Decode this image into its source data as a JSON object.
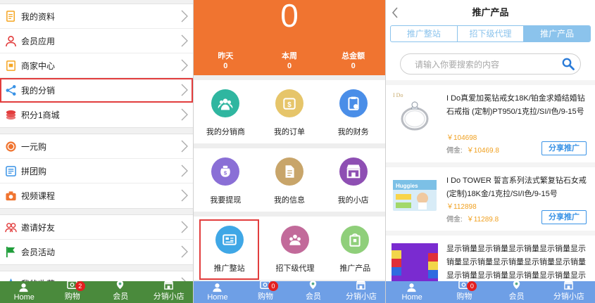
{
  "panel1": {
    "menu_groups": [
      [
        {
          "label": "我的资料",
          "icon": "document-icon",
          "color": "#f5a623"
        },
        {
          "label": "会员应用",
          "icon": "user-icon",
          "color": "#e23d3d"
        },
        {
          "label": "商家中心",
          "icon": "store-doc-icon",
          "color": "#f5a623"
        },
        {
          "label": "我的分销",
          "icon": "share-icon",
          "color": "#3a93e6",
          "selected": true
        },
        {
          "label": "积分1商城",
          "icon": "coins-icon",
          "color": "#e23d3d"
        }
      ],
      [
        {
          "label": "一元购",
          "icon": "coin-circle-icon",
          "color": "#f07430"
        },
        {
          "label": "拼团购",
          "icon": "group-buy-icon",
          "color": "#3a93e6"
        },
        {
          "label": "视频课程",
          "icon": "camera-icon",
          "color": "#f07430"
        }
      ],
      [
        {
          "label": "邀请好友",
          "icon": "friends-icon",
          "color": "#e23d3d"
        },
        {
          "label": "会员活动",
          "icon": "flag-icon",
          "color": "#1f9d3a"
        }
      ],
      [
        {
          "label": "我的收藏",
          "icon": "star-icon",
          "color": "#3a93e6"
        }
      ]
    ],
    "tabbar": {
      "bg": "#4a8a3c",
      "tabs": [
        {
          "label": "Home",
          "icon": "home-icon"
        },
        {
          "label": "购物",
          "icon": "cart-icon",
          "badge": "2"
        },
        {
          "label": "会员",
          "icon": "member-icon"
        },
        {
          "label": "分销小店",
          "icon": "shop-icon"
        }
      ]
    }
  },
  "panel2": {
    "header_bg": "#f07430",
    "big_number": "0",
    "stats": [
      {
        "label": "昨天",
        "value": "0"
      },
      {
        "label": "本周",
        "value": "0"
      },
      {
        "label": "总金额",
        "value": "0"
      }
    ],
    "grid_rows": [
      [
        {
          "label": "我的分销商",
          "icon": "team-icon",
          "color": "#2fb6a0"
        },
        {
          "label": "我的订单",
          "icon": "money-bag-icon",
          "color": "#e6c56a"
        },
        {
          "label": "我的财务",
          "icon": "finance-icon",
          "color": "#4a8ee8"
        }
      ],
      [
        {
          "label": "我要提现",
          "icon": "wallet-bag-icon",
          "color": "#8a6fd6"
        },
        {
          "label": "我的信息",
          "icon": "info-doc-icon",
          "color": "#c8a56a"
        },
        {
          "label": "我的小店",
          "icon": "shop-icon",
          "color": "#8e4fb3"
        }
      ],
      [
        {
          "label": "推广整站",
          "icon": "site-card-icon",
          "color": "#3fa7e6",
          "selected": true
        },
        {
          "label": "招下级代理",
          "icon": "agents-icon",
          "color": "#c26a9a"
        },
        {
          "label": "推广产品",
          "icon": "product-icon",
          "color": "#8fcf7a"
        }
      ]
    ],
    "tabbar": {
      "bg": "#6e9fe6",
      "tabs": [
        {
          "label": "Home",
          "icon": "home-icon"
        },
        {
          "label": "购物",
          "icon": "cart-icon",
          "badge": "0"
        },
        {
          "label": "会员",
          "icon": "member-icon"
        },
        {
          "label": "分销小店",
          "icon": "shop-icon"
        }
      ]
    }
  },
  "panel3": {
    "title": "推广产品",
    "segments": [
      "推广整站",
      "招下级代理",
      "推广产品"
    ],
    "search_placeholder": "请输入你要搜索的内容",
    "products": [
      {
        "name": "I Do真爱加冕钻戒女18K/铂金求婚结婚钻石戒指 (定制)PT950/1克拉/SI/I色/9-15号",
        "price": "￥104698",
        "commission_label": "佣金:",
        "commission": "￥10469.8",
        "share_label": "分享推广",
        "thumb": "ring"
      },
      {
        "name": "I Do TOWER 誓言系列法式繁复钻石女戒 (定制)18K金/1克拉/SI/I色/9-15号",
        "price": "￥112898",
        "commission_label": "佣金:",
        "commission": "￥11289.8",
        "share_label": "分享推广",
        "thumb": "diapers"
      },
      {
        "name": "显示销量显示销量显示销量显示销量显示销量显示销量显示销量显示销量显示销量显示销量显示销量显示销量显示销量显示销量显示销量显示销量",
        "thumb": "colorful"
      }
    ],
    "tabbar": {
      "bg": "#6e9fe6",
      "tabs": [
        {
          "label": "Home",
          "icon": "home-icon"
        },
        {
          "label": "购物",
          "icon": "cart-icon",
          "badge": "0"
        },
        {
          "label": "会员",
          "icon": "member-icon"
        },
        {
          "label": "分销小店",
          "icon": "shop-icon"
        }
      ]
    }
  }
}
